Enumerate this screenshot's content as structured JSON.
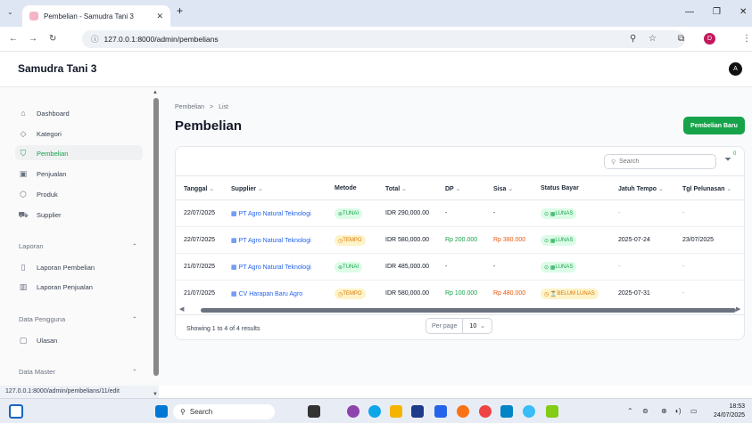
{
  "browser": {
    "tab_title": "Pembelian - Samudra Tani 3",
    "url": "127.0.0.1:8000/admin/pembelians",
    "status_url": "127.0.0.1:8000/admin/pembelians/11/edit"
  },
  "app": {
    "brand": "Samudra Tani 3",
    "avatar": "A"
  },
  "sidebar": {
    "items": [
      {
        "label": "Dashboard",
        "icon": "home-icon"
      },
      {
        "label": "Kategori",
        "icon": "tag-icon"
      },
      {
        "label": "Pembelian",
        "icon": "bag-icon",
        "active": true
      },
      {
        "label": "Penjualan",
        "icon": "cash-icon"
      },
      {
        "label": "Produk",
        "icon": "cube-icon"
      },
      {
        "label": "Supplier",
        "icon": "truck-icon"
      }
    ],
    "groups": {
      "laporan": "Laporan",
      "laporan_pembelian": "Laporan Pembelian",
      "laporan_penjualan": "Laporan Penjualan",
      "data_pengguna": "Data Pengguna",
      "ulasan": "Ulasan",
      "data_master": "Data Master"
    }
  },
  "page": {
    "breadcrumb_root": "Pembelian",
    "breadcrumb_sep": ">",
    "breadcrumb_leaf": "List",
    "title": "Pembelian",
    "new_button": "Pembelian Baru",
    "search_placeholder": "Search",
    "filter_count": "0"
  },
  "table": {
    "headers": {
      "tanggal": "Tanggal",
      "supplier": "Supplier",
      "metode": "Metode",
      "total": "Total",
      "dp": "DP",
      "sisa": "Sisa",
      "status": "Status Bayar",
      "jatuh_tempo": "Jatuh Tempo",
      "tgl_pelunasan": "Tgl Pelunasan"
    },
    "rows": [
      {
        "tanggal": "22/07/2025",
        "supplier": "PT Agro Natural Teknologi",
        "metode": "TUNAI",
        "total": "IDR 290,000.00",
        "dp": "-",
        "sisa": "-",
        "status": "LUNAS",
        "jatuh_tempo": "-",
        "tgl_pelunasan": "-"
      },
      {
        "tanggal": "22/07/2025",
        "supplier": "PT Agro Natural Teknologi",
        "metode": "TEMPO",
        "total": "IDR 580,000.00",
        "dp": "Rp 200.000",
        "sisa": "Rp 380.000",
        "status": "LUNAS",
        "jatuh_tempo": "2025-07-24",
        "tgl_pelunasan": "23/07/2025"
      },
      {
        "tanggal": "21/07/2025",
        "supplier": "PT Agro Natural Teknologi",
        "metode": "TUNAI",
        "total": "IDR 485,000.00",
        "dp": "-",
        "sisa": "-",
        "status": "LUNAS",
        "jatuh_tempo": "-",
        "tgl_pelunasan": "-"
      },
      {
        "tanggal": "21/07/2025",
        "supplier": "CV Harapan Baru Agro",
        "metode": "TEMPO",
        "total": "IDR 580,000.00",
        "dp": "Rp 100.000",
        "sisa": "Rp 480.000",
        "status": "BELUM LUNAS",
        "jatuh_tempo": "2025-07-31",
        "tgl_pelunasan": "-"
      }
    ],
    "footer_text": "Showing 1 to 4 of 4 results",
    "per_page_label": "Per page",
    "per_page_value": "10"
  },
  "taskbar": {
    "search": "Search",
    "time": "18:53",
    "date": "24/07/2025"
  },
  "colors": {
    "accent": "#16a34a",
    "link": "#2563eb",
    "warning": "#d97706"
  }
}
